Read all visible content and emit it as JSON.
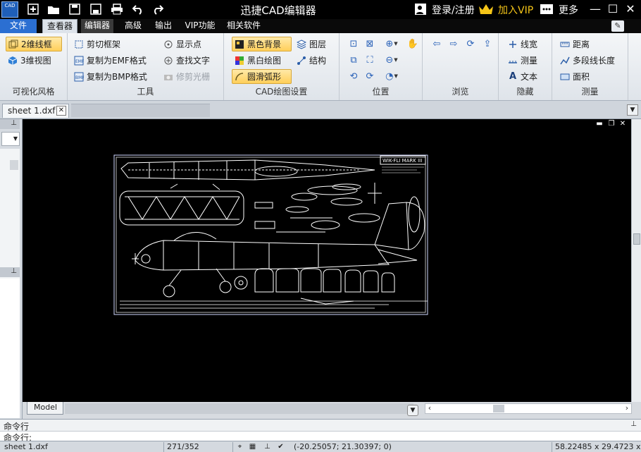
{
  "app": {
    "title": "迅捷CAD编辑器",
    "logo_text": "CAD",
    "login": "登录/注册",
    "vip": "加入VIP",
    "more": "更多"
  },
  "menu": {
    "file": "文件",
    "viewer": "查看器",
    "editor": "编辑器",
    "advanced": "高级",
    "output": "输出",
    "vip": "VIP功能",
    "related": "相关软件"
  },
  "ribbon": {
    "visual_style": {
      "label": "可视化风格",
      "wire2d": "2维线框",
      "view3d": "3维视图"
    },
    "tools": {
      "label": "工具",
      "clip_frame": "剪切框架",
      "copy_emf": "复制为EMF格式",
      "copy_bmp": "复制为BMP格式",
      "show_points": "显示点",
      "find_text": "查找文字",
      "trim_raster": "修剪光栅"
    },
    "cad_settings": {
      "label": "CAD绘图设置",
      "black_bg": "黑色背景",
      "bw_drawing": "黑白绘图",
      "smooth_arc": "圆滑弧形",
      "layers": "图层",
      "structure": "结构"
    },
    "position": {
      "label": "位置"
    },
    "browse": {
      "label": "浏览"
    },
    "hide": {
      "label": "隐藏",
      "line_width": "线宽",
      "measure": "测量",
      "text": "文本"
    },
    "measure": {
      "label": "测量",
      "distance": "距离",
      "polyline_length": "多段线长度",
      "area": "面积"
    }
  },
  "document": {
    "tab": "sheet 1.dxf"
  },
  "drawing": {
    "title_block": "WIK-FLI MARK III"
  },
  "layout": {
    "model_tab": "Model"
  },
  "command": {
    "title": "命令行",
    "prompt": "命令行:"
  },
  "status": {
    "file": "sheet 1.dxf",
    "page": "271/352",
    "cursor": "(-20.25057; 21.30397; 0)",
    "size": "58.22485 x 29.4723 x 0"
  },
  "colors": {
    "title_bar": "#000000",
    "file_tab": "#2b6fd2",
    "active_ribbon_button": "#ffcf5a",
    "canvas": "#000000",
    "drawing_lines": "#ffffff"
  }
}
